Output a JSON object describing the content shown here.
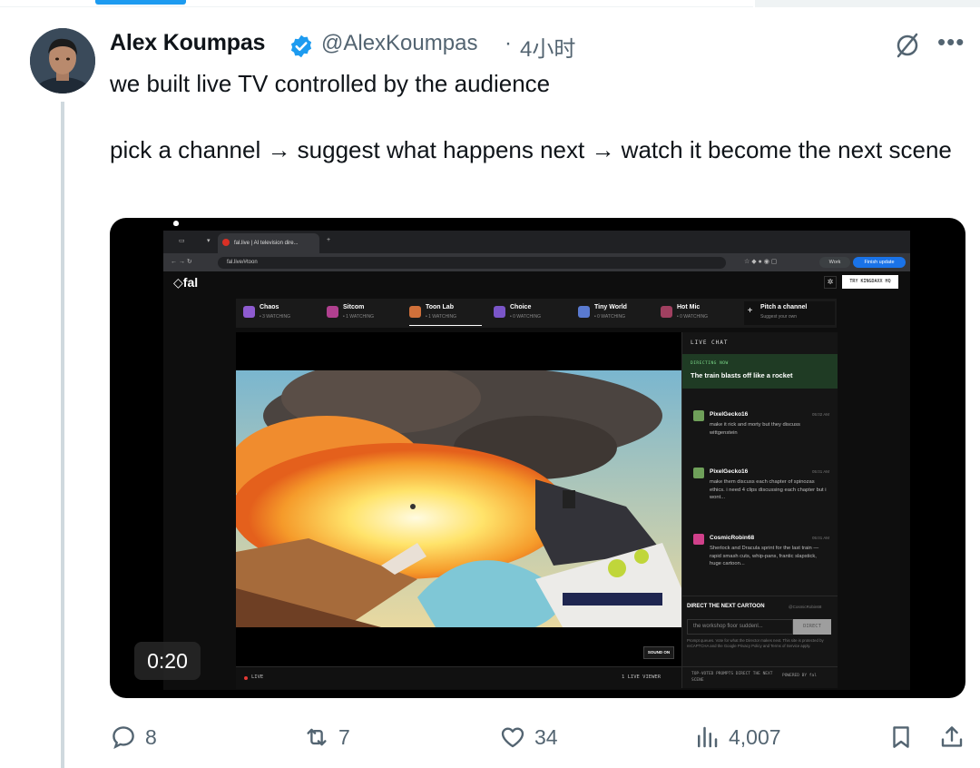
{
  "author": {
    "name": "Alex Koumpas",
    "handle": "@AlexKoumpas",
    "separator": "·",
    "time": "4小时"
  },
  "tweet": {
    "line1": "we built live TV controlled by the audience",
    "line2": "pick a channel → suggest what happens next → watch it become the next scene"
  },
  "video": {
    "duration": "0:20",
    "browser": {
      "tab_title": "fal.live | AI television dire...",
      "url": "fal.live/#toon",
      "work_label": "Work",
      "finish_update": "Finish update"
    },
    "site": {
      "logo": "fal",
      "try_button": "TRY KINGDAXX HQ",
      "channels": [
        {
          "title": "Chaos",
          "sub": "• 3 WATCHING",
          "color": "#8e5bd0"
        },
        {
          "title": "Sitcom",
          "sub": "• 1 WATCHING",
          "color": "#b0408f"
        },
        {
          "title": "Toon Lab",
          "sub": "• 1 WATCHING",
          "color": "#d0703a"
        },
        {
          "title": "Choice",
          "sub": "• 0 WATCHING",
          "color": "#7a55c8"
        },
        {
          "title": "Tiny World",
          "sub": "• 0 WATCHING",
          "color": "#5a7ad0"
        },
        {
          "title": "Hot Mic",
          "sub": "• 0 WATCHING",
          "color": "#a04060"
        },
        {
          "title": "Pitch a channel",
          "sub": "Suggest your own",
          "color": "#1a1a1a"
        }
      ],
      "sound_button": "SOUND ON",
      "live_label": "LIVE",
      "viewer_count": "1 LIVE VIEWER",
      "chat": {
        "header": "LIVE CHAT",
        "directing_label": "DIRECTING NOW",
        "directing_text": "The train blasts off like a rocket",
        "messages": [
          {
            "user": "PixelGecko16",
            "time": "05:02 AM",
            "text": "make it rick and morty but they discuss wittgenstein",
            "color": "#6fa05a"
          },
          {
            "user": "PixelGecko16",
            "time": "05:01 AM",
            "text": "make them discuss each chapter of spinozas ethics. i need 4 clips discussing each chapter but i wont...",
            "color": "#6fa05a"
          },
          {
            "user": "CosmicRobin68",
            "time": "05:01 AM",
            "text": "Sherlock and Dracula sprint for the last train — rapid smash cuts, whip-pans, frantic slapstick, huge cartoon...",
            "color": "#d0408a"
          }
        ],
        "direct_title": "DIRECT THE NEXT CARTOON",
        "direct_user": "@CosmicRobin68",
        "direct_placeholder": "the workshop floor suddenl...",
        "direct_button": "DIRECT",
        "direct_hint": "Prompt queues. Vote for what the Director makes next. This site is protected by reCAPTCHA and the Google Privacy Policy and Terms of Service apply.",
        "footer_prompts": "TOP-VOTED PROMPTS DIRECT THE NEXT SCENE",
        "footer_powered": "POWERED BY fal"
      }
    }
  },
  "actions": {
    "replies": "8",
    "reposts": "7",
    "likes": "34",
    "views": "4,007"
  },
  "colors": {
    "accent": "#1d9bf0",
    "secondary_text": "#536471",
    "primary_text": "#0f1419"
  }
}
